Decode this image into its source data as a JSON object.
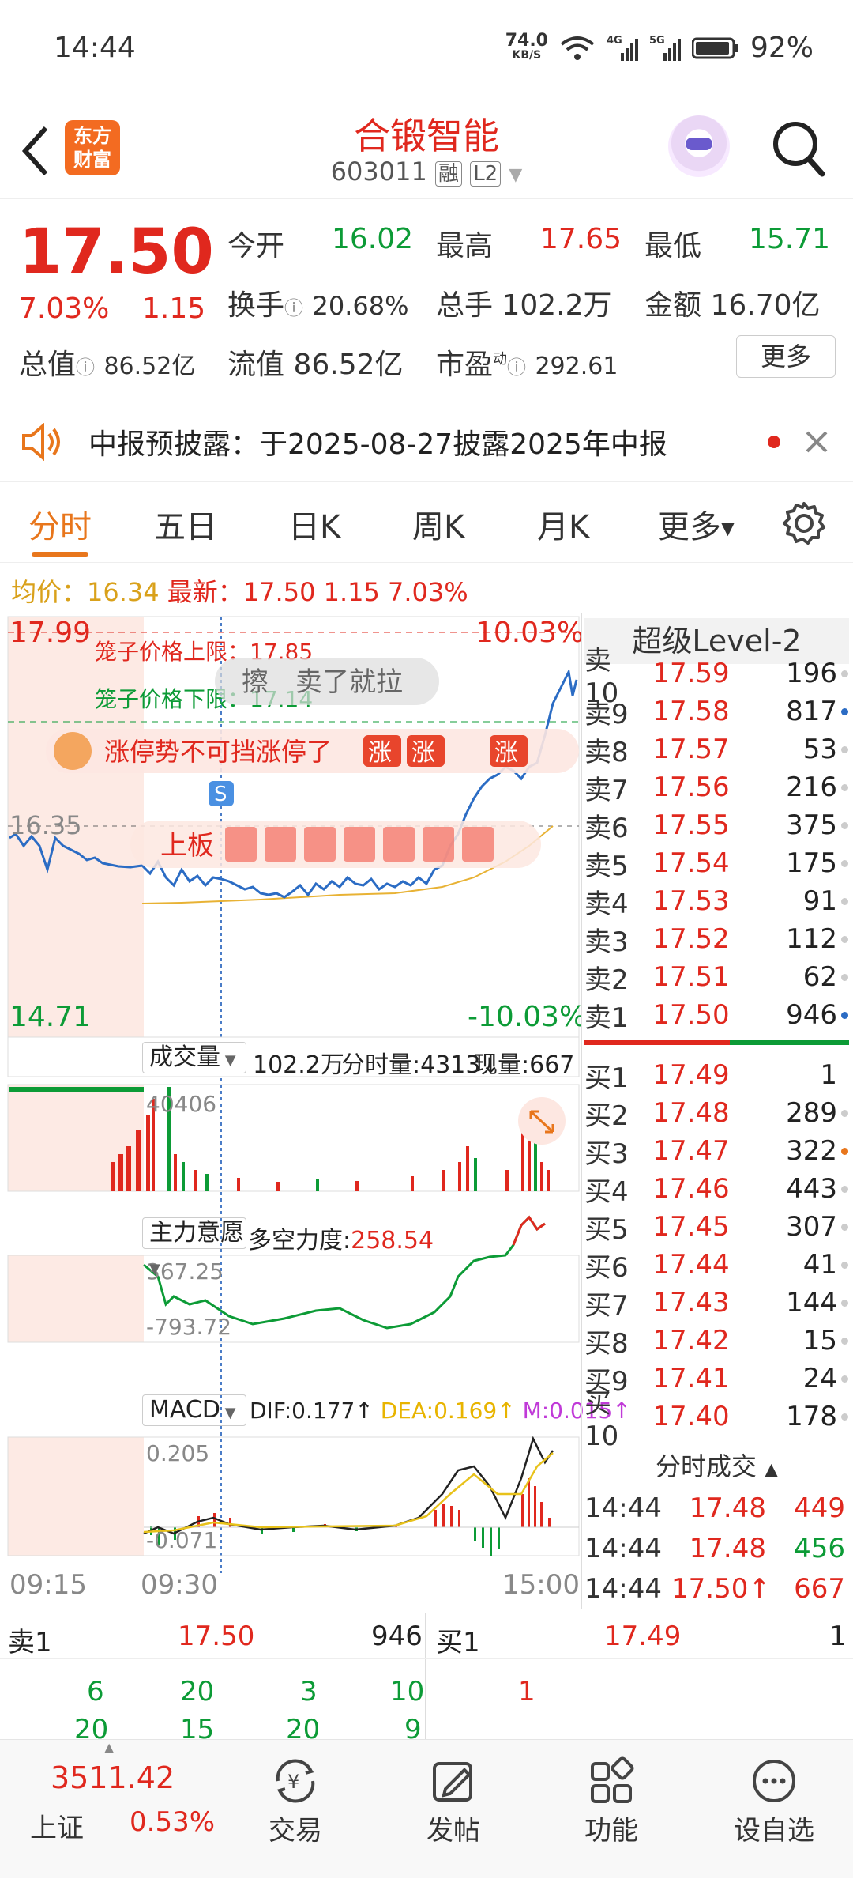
{
  "status": {
    "time": "14:44",
    "net_speed": "74.0",
    "net_unit": "KB/S",
    "battery": "92%"
  },
  "header": {
    "logo_line1": "东方",
    "logo_line2": "财富",
    "stock_name": "合锻智能",
    "stock_code": "603011",
    "tag_rong": "融",
    "tag_l2": "L2"
  },
  "quote": {
    "price": "17.50",
    "pct": "7.03%",
    "chg": "1.15",
    "open_label": "今开",
    "open": "16.02",
    "high_label": "最高",
    "high": "17.65",
    "low_label": "最低",
    "low": "15.71",
    "turnover_label": "换手",
    "turnover": "20.68%",
    "vol_label": "总手",
    "vol": "102.2万",
    "amount_label": "金额",
    "amount": "16.70亿",
    "mcap_label": "总值",
    "mcap": "86.52亿",
    "float_label": "流值",
    "float": "86.52亿",
    "pe_label": "市盈",
    "pe_sup": "动",
    "pe": "292.61",
    "more": "更多"
  },
  "notice": {
    "text": "中报预披露：于2025-08-27披露2025年中报"
  },
  "tabs": [
    "分时",
    "五日",
    "日K",
    "周K",
    "月K",
    "更多"
  ],
  "avgline": {
    "avg_label": "均价：",
    "avg": "16.34",
    "last_label": "最新：",
    "last": "17.50",
    "chg": "1.15",
    "pct": "7.03%"
  },
  "chart": {
    "ymax": "17.99",
    "ymin": "14.71",
    "pmax": "10.03%",
    "pmin": "-10.03%",
    "mid": "16.35",
    "cage_up": "笼子价格上限：17.85",
    "cage_down": "笼子价格下限：17.14",
    "bullet": "擦　卖了就拉",
    "banner": "涨停势不可挡涨停了",
    "banner_badge": "涨",
    "limit_up": "上板",
    "s_marker": "S"
  },
  "volume": {
    "label": "成交量",
    "total": "102.2万",
    "tick_label": "分时量:4313↓",
    "now_label": "现量:667",
    "max": "40406"
  },
  "mainforce": {
    "label": "主力意愿",
    "power_label": "多空力度:",
    "power": "258.54",
    "max": "367.25",
    "min": "-793.72"
  },
  "macd": {
    "label": "MACD",
    "dif": "DIF:0.177↑",
    "dea": "DEA:0.169↑",
    "m": "M:0.015↑",
    "max": "0.205",
    "min": "-0.071"
  },
  "time_axis": [
    "09:15",
    "09:30",
    "15:00"
  ],
  "orderbook": {
    "title": "超级Level-2",
    "sells": [
      [
        "卖10",
        "17.59",
        "196"
      ],
      [
        "卖9",
        "17.58",
        "817"
      ],
      [
        "卖8",
        "17.57",
        "53"
      ],
      [
        "卖7",
        "17.56",
        "216"
      ],
      [
        "卖6",
        "17.55",
        "375"
      ],
      [
        "卖5",
        "17.54",
        "175"
      ],
      [
        "卖4",
        "17.53",
        "91"
      ],
      [
        "卖3",
        "17.52",
        "112"
      ],
      [
        "卖2",
        "17.51",
        "62"
      ],
      [
        "卖1",
        "17.50",
        "946"
      ]
    ],
    "buys": [
      [
        "买1",
        "17.49",
        "1"
      ],
      [
        "买2",
        "17.48",
        "289"
      ],
      [
        "买3",
        "17.47",
        "322"
      ],
      [
        "买4",
        "17.46",
        "443"
      ],
      [
        "买5",
        "17.45",
        "307"
      ],
      [
        "买6",
        "17.44",
        "41"
      ],
      [
        "买7",
        "17.43",
        "144"
      ],
      [
        "买8",
        "17.42",
        "15"
      ],
      [
        "买9",
        "17.41",
        "24"
      ],
      [
        "买10",
        "17.40",
        "178"
      ]
    ]
  },
  "trades": {
    "title": "分时成交",
    "rows": [
      [
        "14:44",
        "17.48",
        "449"
      ],
      [
        "14:44",
        "17.48",
        "456"
      ],
      [
        "14:44",
        "17.50↑",
        "667"
      ]
    ]
  },
  "queue": {
    "sell_label": "卖1",
    "sell_price": "17.50",
    "sell_vol": "946",
    "buy_label": "买1",
    "buy_price": "17.49",
    "buy_vol": "1",
    "sell_row1": [
      "6",
      "20",
      "3",
      "10"
    ],
    "sell_row2": [
      "20",
      "15",
      "20",
      "9"
    ],
    "buy_row1": [
      "1"
    ]
  },
  "nav": {
    "index_value": "3511.42",
    "index_name": "上证",
    "index_pct": "0.53%",
    "items": [
      "交易",
      "发帖",
      "功能",
      "设自选"
    ]
  }
}
